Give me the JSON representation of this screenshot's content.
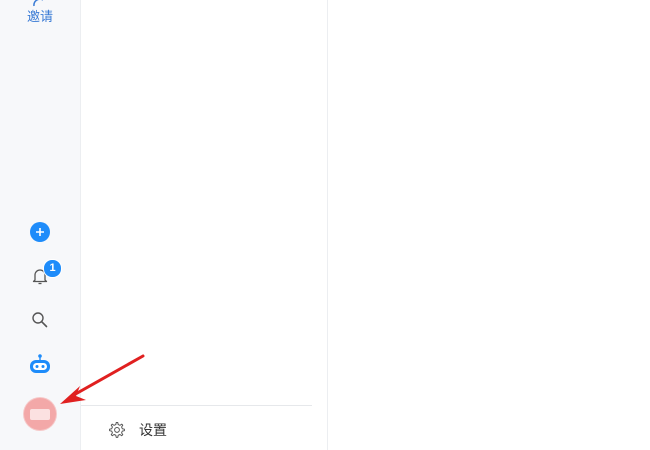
{
  "rail": {
    "invite_label": "邀请",
    "notifications_count": "1"
  },
  "panel": {
    "settings_label": "设置"
  },
  "colors": {
    "accent": "#1e8cfa",
    "avatar": "#f3a8a8",
    "arrow": "#e02020"
  },
  "icons": [
    "add-user-icon",
    "plus-icon",
    "bell-icon",
    "search-icon",
    "robot-icon",
    "gear-icon"
  ]
}
